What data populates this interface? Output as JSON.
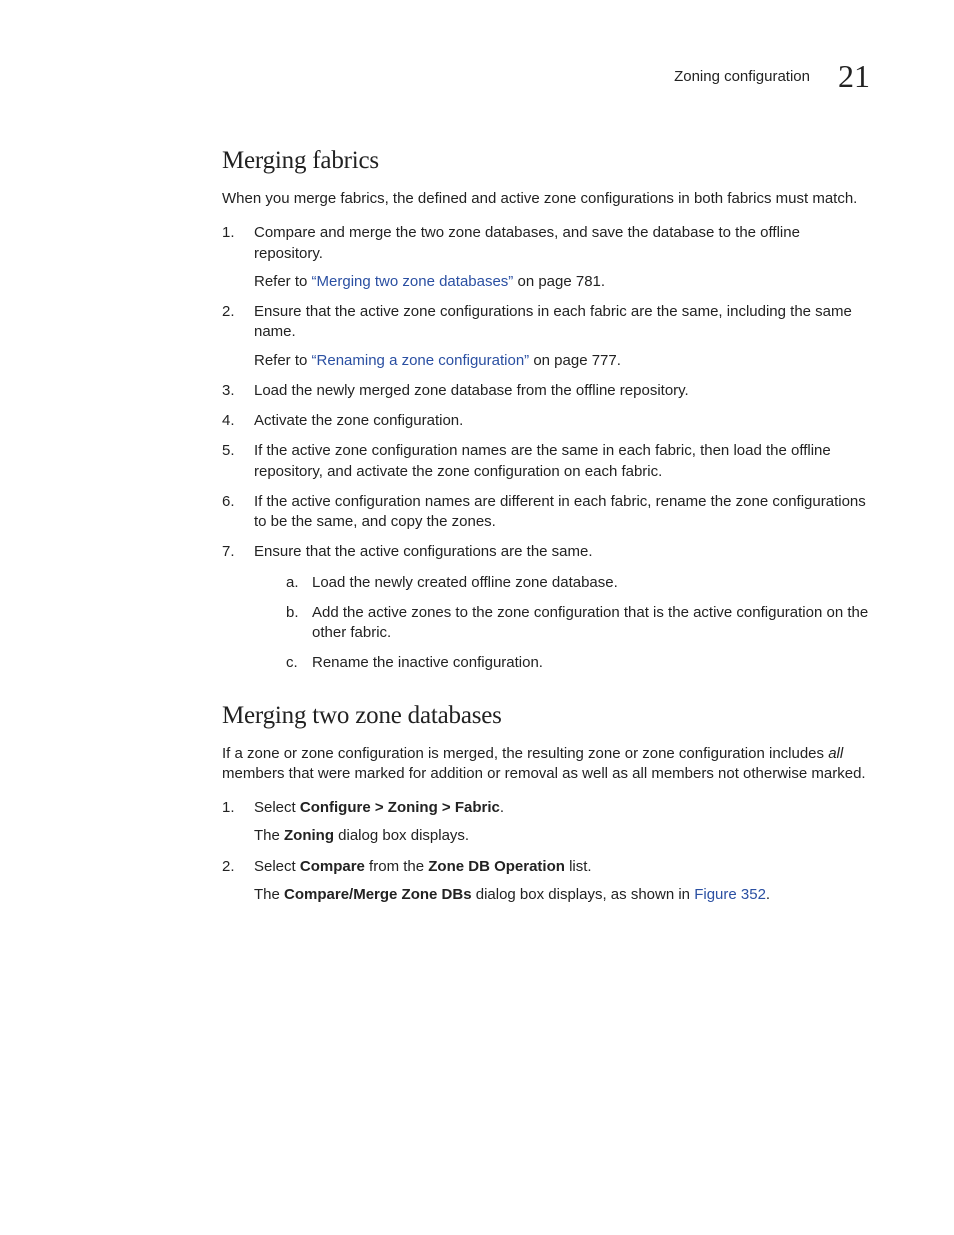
{
  "header": {
    "section_title": "Zoning configuration",
    "chapter_number": "21"
  },
  "section1": {
    "heading": "Merging fabrics",
    "intro": "When you merge fabrics, the defined and active zone configurations in both fabrics must match.",
    "steps": [
      {
        "num": "1.",
        "text": "Compare and merge the two zone databases, and save the database to the offline repository.",
        "refer_prefix": "Refer to ",
        "refer_link": "“Merging two zone databases”",
        "refer_suffix": " on page 781."
      },
      {
        "num": "2.",
        "text": "Ensure that the active zone configurations in each fabric are the same, including the same name.",
        "refer_prefix": "Refer to ",
        "refer_link": "“Renaming a zone configuration”",
        "refer_suffix": " on page 777."
      },
      {
        "num": "3.",
        "text": "Load the newly merged zone database from the offline repository."
      },
      {
        "num": "4.",
        "text": "Activate the zone configuration."
      },
      {
        "num": "5.",
        "text": "If the active zone configuration names are the same in each fabric, then load the offline repository, and activate the zone configuration on each fabric."
      },
      {
        "num": "6.",
        "text": "If the active configuration names are different in each fabric, rename the zone configurations to be the same, and copy the zones."
      },
      {
        "num": "7.",
        "text": "Ensure that the active configurations are the same.",
        "sub": [
          {
            "letter": "a.",
            "text": "Load the newly created offline zone database."
          },
          {
            "letter": "b.",
            "text": "Add the active zones to the zone configuration that is the active configuration on the other fabric."
          },
          {
            "letter": "c.",
            "text": "Rename the inactive configuration."
          }
        ]
      }
    ]
  },
  "section2": {
    "heading": "Merging two zone databases",
    "intro_pre": "If a zone or zone configuration is merged, the resulting zone or zone configuration includes ",
    "intro_em": "all",
    "intro_post": " members that were marked for addition or removal as well as all members not otherwise marked.",
    "steps": [
      {
        "num": "1.",
        "pre": "Select ",
        "bold": "Configure > Zoning > Fabric",
        "post": ".",
        "note_pre": "The ",
        "note_bold": "Zoning",
        "note_post": " dialog box displays."
      },
      {
        "num": "2.",
        "pre": "Select ",
        "bold1": "Compare",
        "mid": " from the ",
        "bold2": "Zone DB Operation",
        "post": " list.",
        "note_pre": "The ",
        "note_bold": "Compare/Merge Zone DBs",
        "note_mid": " dialog box displays, as shown in ",
        "note_link": "Figure 352",
        "note_end": "."
      }
    ]
  }
}
